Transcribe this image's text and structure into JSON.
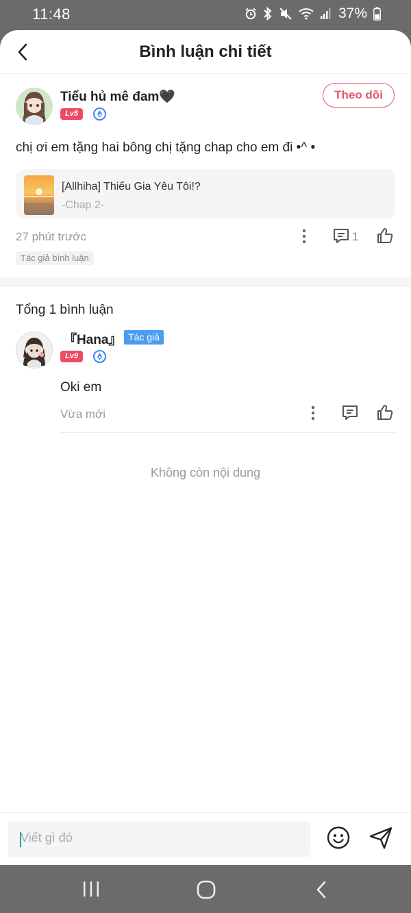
{
  "status_bar": {
    "time": "11:48",
    "battery": "37%",
    "icons": [
      "alarm-icon",
      "bluetooth-icon",
      "mute-icon",
      "wifi-icon",
      "signal-icon",
      "battery-icon"
    ]
  },
  "header": {
    "title": "Bình luận chi tiết",
    "back_icon": "chevron-left-icon"
  },
  "post": {
    "username": "Tiểu hủ mê đam🖤",
    "level": "Lv5",
    "follow_label": "Theo dõi",
    "text": "chị ơi em tặng hai bông chị tặng chap cho em đi •^ •",
    "manga": {
      "title": "[Allhiha] Thiếu Gia Yêu Tôi!?",
      "chapter": "-Chap 2-"
    },
    "time": "27 phút trước",
    "reply_count": "1",
    "author_tag": "Tác giả bình luận"
  },
  "comments": {
    "total_label": "Tổng 1 bình luận",
    "items": [
      {
        "username": "『Hana』",
        "author_badge": "Tác giả",
        "level": "Lv9",
        "text": "Oki em",
        "time": "Vừa mới"
      }
    ]
  },
  "end_text": "Không còn nội dung",
  "input": {
    "placeholder": "Viết gì đó"
  },
  "colors": {
    "accent": "#e8566c",
    "level_badge": "#ef4a66",
    "author_badge": "#4a9cf0",
    "verify_badge": "#3b82f6"
  }
}
